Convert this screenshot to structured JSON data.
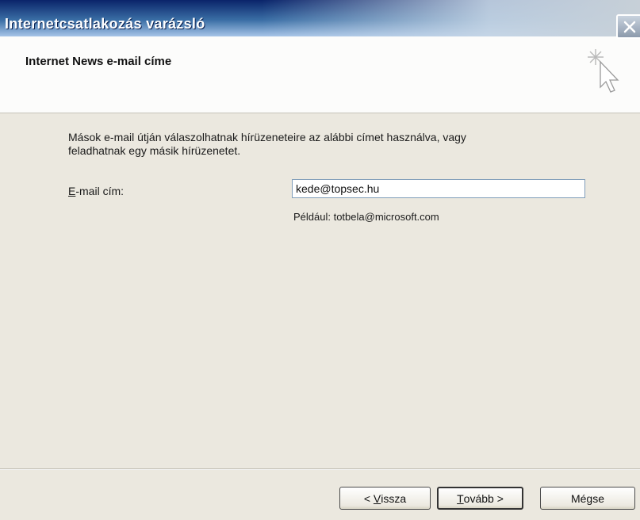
{
  "window": {
    "title": "Internetcsatlakozás varázsló"
  },
  "header": {
    "title": "Internet News e-mail címe"
  },
  "content": {
    "description_line1": "Mások e-mail útján válaszolhatnak hírüzeneteire az alábbi címet használva, vagy",
    "description_line2": "feladhatnak egy másik hírüzenetet.",
    "email_label_mnemonic": "E",
    "email_label_rest": "-mail cím:",
    "email_value": "kede@topsec.hu",
    "example": "Például: totbela@microsoft.com"
  },
  "buttons": {
    "back_prefix": "< ",
    "back_mnemonic": "V",
    "back_rest": "issza",
    "next_mnemonic": "T",
    "next_rest": "ovább >",
    "cancel": "Mégse"
  },
  "icons": {
    "close": "close-icon",
    "wizard": "wizard-cursor-icon"
  },
  "colors": {
    "titlebar": "#0a246a",
    "header_bg": "#fcfcfb",
    "dialog_bg": "#ebe8df",
    "input_border": "#7f9db9"
  }
}
